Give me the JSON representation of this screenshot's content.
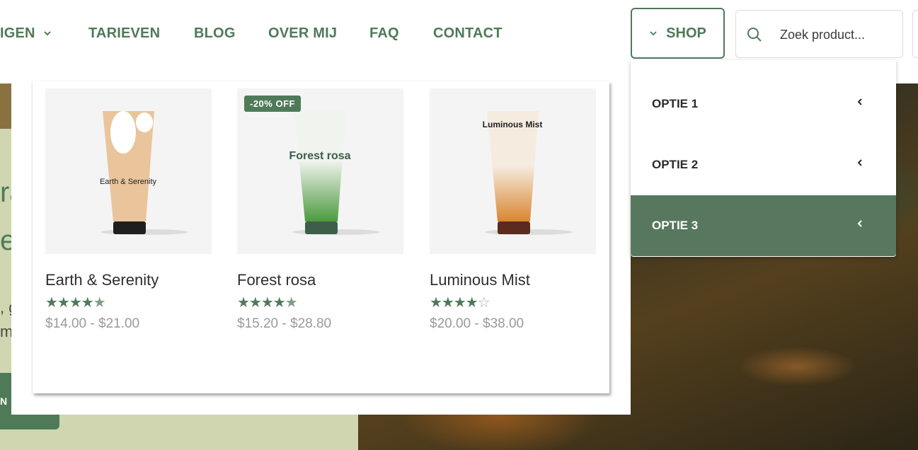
{
  "header": {
    "nav": [
      {
        "label": "IGEN",
        "has_dropdown": true
      },
      {
        "label": "TARIEVEN"
      },
      {
        "label": "BLOG"
      },
      {
        "label": "OVER MIJ"
      },
      {
        "label": "FAQ"
      },
      {
        "label": "CONTACT"
      }
    ],
    "shop_label": "SHOP",
    "search_placeholder": "Zoek product..."
  },
  "hero": {
    "text_fragments": [
      "ra",
      "e",
      ", g",
      "m"
    ],
    "cta_fragment": "N"
  },
  "products": [
    {
      "name": "Earth & Serenity",
      "rating": 4.5,
      "price": "$14.00 - $21.00",
      "badge": "",
      "tube_label": "Earth & Serenity",
      "tube_color": "#eac49a",
      "cap_color": "#1f1f1f"
    },
    {
      "name": "Forest rosa",
      "rating": 4.5,
      "price": "$15.20 - $28.80",
      "badge": "-20% OFF",
      "tube_label": "Forest rosa",
      "tube_color": "#eef2ea",
      "cap_color": "#3e5e49"
    },
    {
      "name": "Luminous Mist",
      "rating": 4,
      "price": "$20.00 - $38.00",
      "badge": "",
      "tube_label": "Luminous Mist",
      "tube_color": "#f3e7d8",
      "cap_color": "#5a2b1e"
    }
  ],
  "options": [
    {
      "label": "OPTIE 1",
      "active": false
    },
    {
      "label": "OPTIE 2",
      "active": false
    },
    {
      "label": "OPTIE 3",
      "active": true
    }
  ],
  "colors": {
    "accent": "#4f7a58",
    "active_option": "#57785e",
    "hero_green": "#cfd6b0"
  }
}
